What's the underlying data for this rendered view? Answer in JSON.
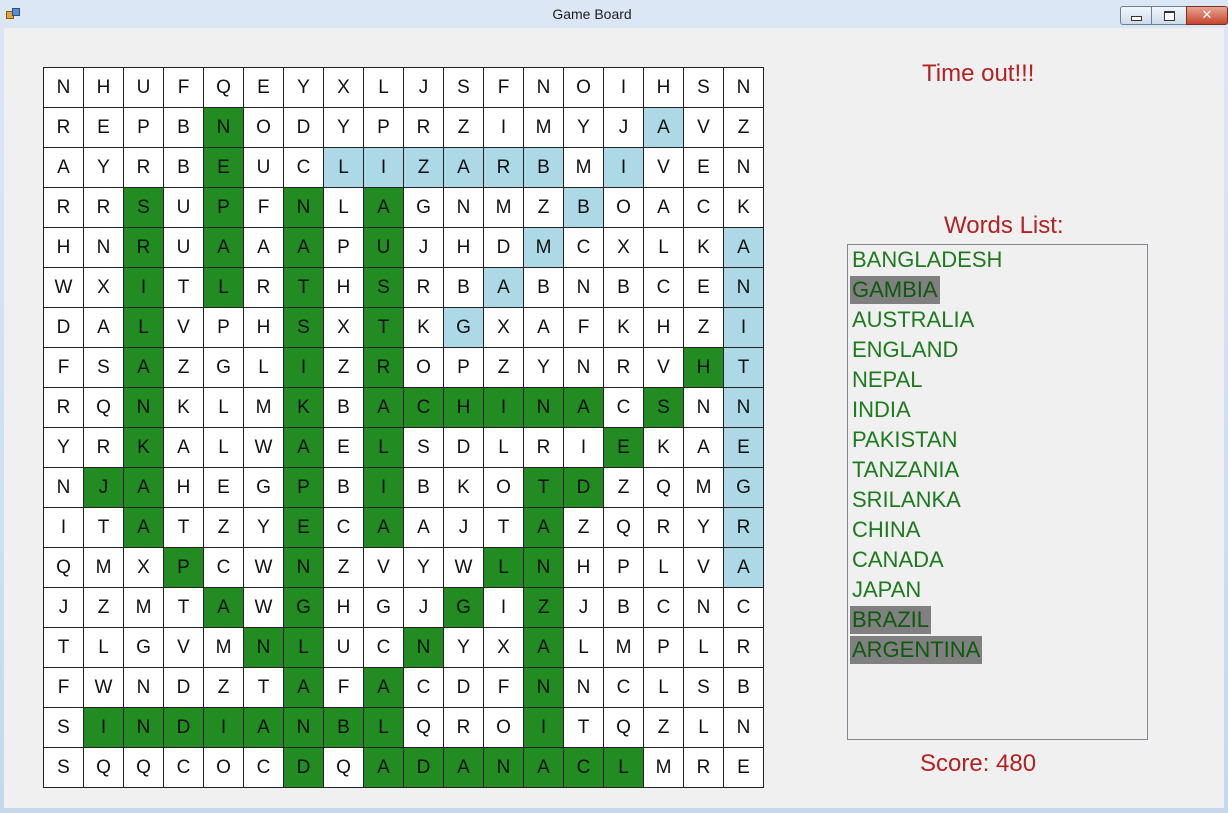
{
  "window": {
    "title": "Game Board"
  },
  "grid": {
    "rows": [
      "NHUFQEYXLJSFNOIHSN",
      "REPBNODYPRZIMYJAVZ",
      "AYRBEUCLIZARBMIVEN",
      "RRSUPFNLAGNMZBOACK",
      "HNRUAAAPUJHDMCXLKA",
      "WXITLRTHSRBABNBCEN",
      "DALVPHSXTKGXAFKHZI",
      "FSAZGLIZROPZYNRVHT",
      "RQNKLMKBACHINACSNN",
      "YRKALWAELSDLRIEKAE",
      "NJAHEGPBIBKOTDZQMG",
      "ITATZYECAAJTAZQRYR",
      "QMXPCWNZVYWLNHPLVA",
      "JZMTAWGHGJGIZJBCNC",
      "TLGVMNLUCNYXALMPLR",
      "FWNDZTAFACDFNNCLSB",
      "SINDIANBLQROITQZLN",
      "SQQCOCDQADANACLMRE"
    ],
    "highlights": [
      "..................",
      "....g..........b..",
      "....g..bbbbbb.b...",
      "..g.g.g.g....b....",
      "..g.g.g.g...b....b",
      "..g.g.g.g..b.....b",
      "..g...g.g.b......b",
      "..g...g.g.......gb",
      "..g...g.gggggg.g.b",
      "..g...g.g.....g..b",
      ".gg...g.g...gg...b",
      "..g...g.g...g....b",
      "...g..g....gg....b",
      "....g.g...g.g.....",
      ".....gg..g..g.....",
      "......g.g...g.....",
      ".gggggggg...g.....",
      "......g.ggggggg..."
    ]
  },
  "status": {
    "message": "Time out!!!"
  },
  "words_panel": {
    "title": "Words List:",
    "words": [
      {
        "text": "BANGLADESH",
        "found": false
      },
      {
        "text": "GAMBIA",
        "found": true
      },
      {
        "text": "AUSTRALIA",
        "found": false
      },
      {
        "text": "ENGLAND",
        "found": false
      },
      {
        "text": "NEPAL",
        "found": false
      },
      {
        "text": "INDIA",
        "found": false
      },
      {
        "text": "PAKISTAN",
        "found": false
      },
      {
        "text": "TANZANIA",
        "found": false
      },
      {
        "text": "SRILANKA",
        "found": false
      },
      {
        "text": "CHINA",
        "found": false
      },
      {
        "text": "CANADA",
        "found": false
      },
      {
        "text": "JAPAN",
        "found": false
      },
      {
        "text": "BRAZIL",
        "found": true
      },
      {
        "text": "ARGENTINA",
        "found": true
      }
    ]
  },
  "score": {
    "text": "Score: 480"
  },
  "colors": {
    "found_cell": "#228b22",
    "blue_cell": "#add8e6",
    "heading": "#b22222",
    "word_text": "#1e7a1e",
    "found_word_bg": "#808080"
  },
  "icons": {
    "app": "app-icon",
    "minimize": "minimize-icon",
    "maximize": "maximize-icon",
    "close": "close-icon"
  }
}
